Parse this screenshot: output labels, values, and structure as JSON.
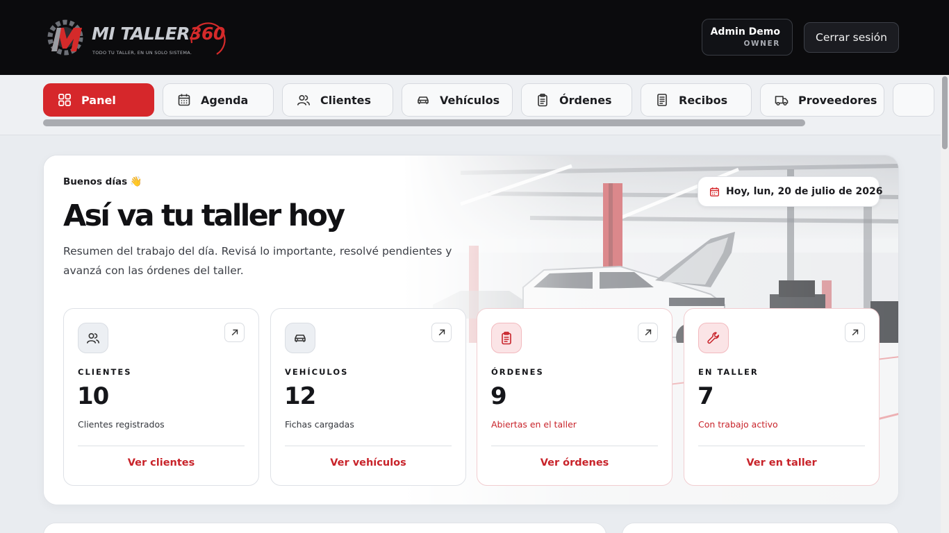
{
  "brand": {
    "title_main": "MI TALLER",
    "title_num": "360",
    "tagline": "TODO TU TALLER, EN UN SOLO SISTEMA."
  },
  "header": {
    "user_name": "Admin Demo",
    "user_role": "OWNER",
    "logout_label": "Cerrar sesión"
  },
  "nav": {
    "tabs": [
      {
        "label": "Panel",
        "icon": "grid-icon"
      },
      {
        "label": "Agenda",
        "icon": "calendar-icon"
      },
      {
        "label": "Clientes",
        "icon": "users-icon"
      },
      {
        "label": "Vehículos",
        "icon": "car-icon"
      },
      {
        "label": "Órdenes",
        "icon": "clipboard-icon"
      },
      {
        "label": "Recibos",
        "icon": "receipt-icon"
      },
      {
        "label": "Proveedores",
        "icon": "truck-icon"
      }
    ],
    "active": "Panel"
  },
  "hero": {
    "greeting": "Buenos días",
    "greeting_emoji": "👋",
    "title": "Así va tu taller hoy",
    "subtitle": "Resumen del trabajo del día. Revisá lo importante, resolvé pendientes y avanzá con las órdenes del taller.",
    "date": "Hoy, lun, 20 de julio de 2026"
  },
  "stats": [
    {
      "label": "CLIENTES",
      "value": "10",
      "desc": "Clientes registrados",
      "link": "Ver clientes",
      "icon": "users-icon"
    },
    {
      "label": "VEHÍCULOS",
      "value": "12",
      "desc": "Fichas cargadas",
      "link": "Ver vehículos",
      "icon": "car-icon"
    },
    {
      "label": "ÓRDENES",
      "value": "9",
      "desc": "Abiertas en el taller",
      "link": "Ver órdenes",
      "icon": "clipboard-icon"
    },
    {
      "label": "EN TALLER",
      "value": "7",
      "desc": "Con trabajo activo",
      "link": "Ver en taller",
      "icon": "wrench-icon"
    }
  ],
  "colors": {
    "accent": "#d6272b",
    "header_bg": "#0b0b0d",
    "page_bg": "#e9ecf0"
  }
}
